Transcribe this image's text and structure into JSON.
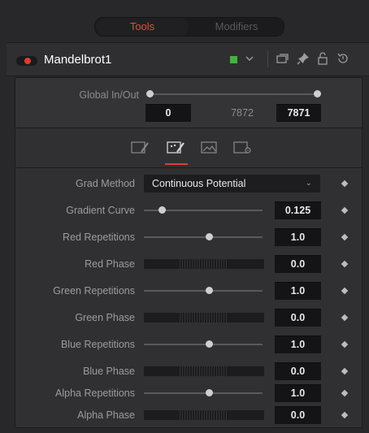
{
  "top_tabs": {
    "tools": "Tools",
    "modifiers": "Modifiers"
  },
  "header": {
    "tool_name": "Mandelbrot1",
    "color_swatch": "#42b33a"
  },
  "global_inout": {
    "label": "Global In/Out",
    "start": "0",
    "mid": "7872",
    "end": "7871"
  },
  "controls": {
    "grad_method": {
      "label": "Grad Method",
      "value": "Continuous Potential"
    },
    "gradient_curve": {
      "label": "Gradient Curve",
      "value": "0.125",
      "slider": 0.15
    },
    "red_repetitions": {
      "label": "Red Repetitions",
      "value": "1.0",
      "slider": 0.55
    },
    "red_phase": {
      "label": "Red Phase",
      "value": "0.0"
    },
    "green_repetitions": {
      "label": "Green Repetitions",
      "value": "1.0",
      "slider": 0.55
    },
    "green_phase": {
      "label": "Green Phase",
      "value": "0.0"
    },
    "blue_repetitions": {
      "label": "Blue Repetitions",
      "value": "1.0",
      "slider": 0.55
    },
    "blue_phase": {
      "label": "Blue Phase",
      "value": "0.0"
    },
    "alpha_repetitions": {
      "label": "Alpha Repetitions",
      "value": "1.0",
      "slider": 0.55
    },
    "alpha_phase": {
      "label": "Alpha Phase",
      "value": "0.0"
    }
  },
  "icons": [
    "toggle-icon",
    "color-swatch-icon",
    "chevron-down-icon",
    "window-icon",
    "pin-icon",
    "lock-icon",
    "reset-icon",
    "controls-tab-icon",
    "color-tab-icon",
    "image-tab-icon",
    "settings-tab-icon",
    "keyframe-diamond-icon"
  ],
  "colors": {
    "accent": "#e23c2f",
    "active_tab_text": "#e64b3c"
  }
}
